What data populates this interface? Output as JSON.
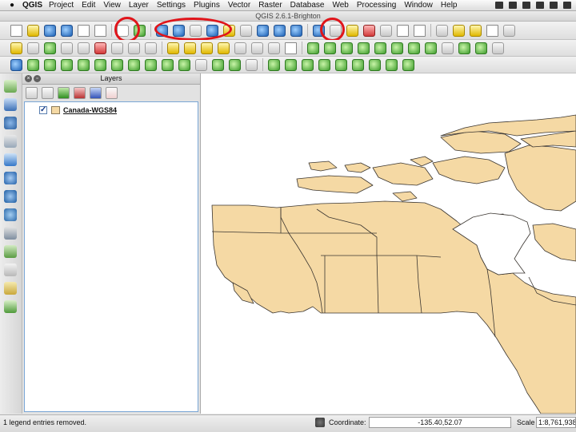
{
  "menubar": {
    "app_name": "QGIS",
    "items": [
      "Project",
      "Edit",
      "View",
      "Layer",
      "Settings",
      "Plugins",
      "Vector",
      "Raster",
      "Database",
      "Web",
      "Processing",
      "Window",
      "Help"
    ]
  },
  "window": {
    "title": "QGIS 2.6.1-Brighton"
  },
  "toolbar_icons": {
    "row1": [
      "new-project-icon",
      "open-project-icon",
      "save-project-icon",
      "save-as-icon",
      "new-print-composer-icon",
      "composer-manager-icon",
      "pan-hand-icon",
      "pan-to-selection-icon",
      "zoom-in-icon",
      "zoom-out-icon",
      "zoom-actual-size-icon",
      "zoom-full-icon",
      "zoom-to-selection-icon",
      "zoom-to-layer-icon",
      "zoom-last-icon",
      "zoom-next-icon",
      "refresh-icon",
      "identify-icon",
      "action-icon",
      "select-icon",
      "deselect-icon",
      "expression-icon",
      "attribute-table-icon",
      "field-calculator-icon",
      "measure-icon",
      "map-tips-icon",
      "bookmark-icon",
      "show-bookmarks-icon",
      "text-annotation-icon"
    ],
    "highlighted": [
      "pan-hand-icon",
      "zoom-group",
      "identify-icon"
    ]
  },
  "layers_panel": {
    "title": "Layers",
    "layer": {
      "name": "Canada-WGS84",
      "checked": true,
      "fill_color": "#f5d9a4"
    }
  },
  "map": {
    "land_color": "#f5d9a4",
    "border_color": "#3a3530",
    "water_color": "#ffffff"
  },
  "highlight_color": "#e0141a",
  "statusbar": {
    "message": "1 legend entries removed.",
    "coordinate_label": "Coordinate:",
    "coordinate_value": "-135.40,52.07",
    "scale_label": "Scale",
    "scale_value": "1:8,761,938"
  }
}
